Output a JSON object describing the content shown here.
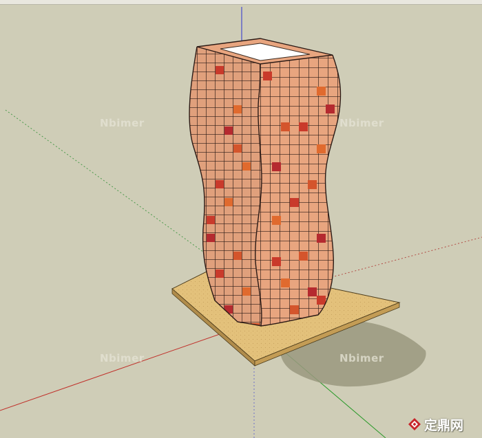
{
  "watermarks": [
    "Nbimer",
    "Nbimer",
    "Nbimer",
    "Nbimer"
  ],
  "brand": {
    "text": "定鼎网",
    "logo_icon": "diamond-logo-icon",
    "accent": "#c8252b"
  },
  "scene": {
    "background": "#cfcdb7",
    "model_base_color": "#e8a57f",
    "base_plate_color": "#e3c17b",
    "top_face_color": "#ffffff",
    "accent_tiles": [
      "#c93a2b",
      "#e06a2e",
      "#b52a2f",
      "#d4552c"
    ],
    "axis_colors": {
      "blue": "#2a2fd0",
      "red": "#c0302a",
      "green": "#2a9a2a"
    }
  }
}
